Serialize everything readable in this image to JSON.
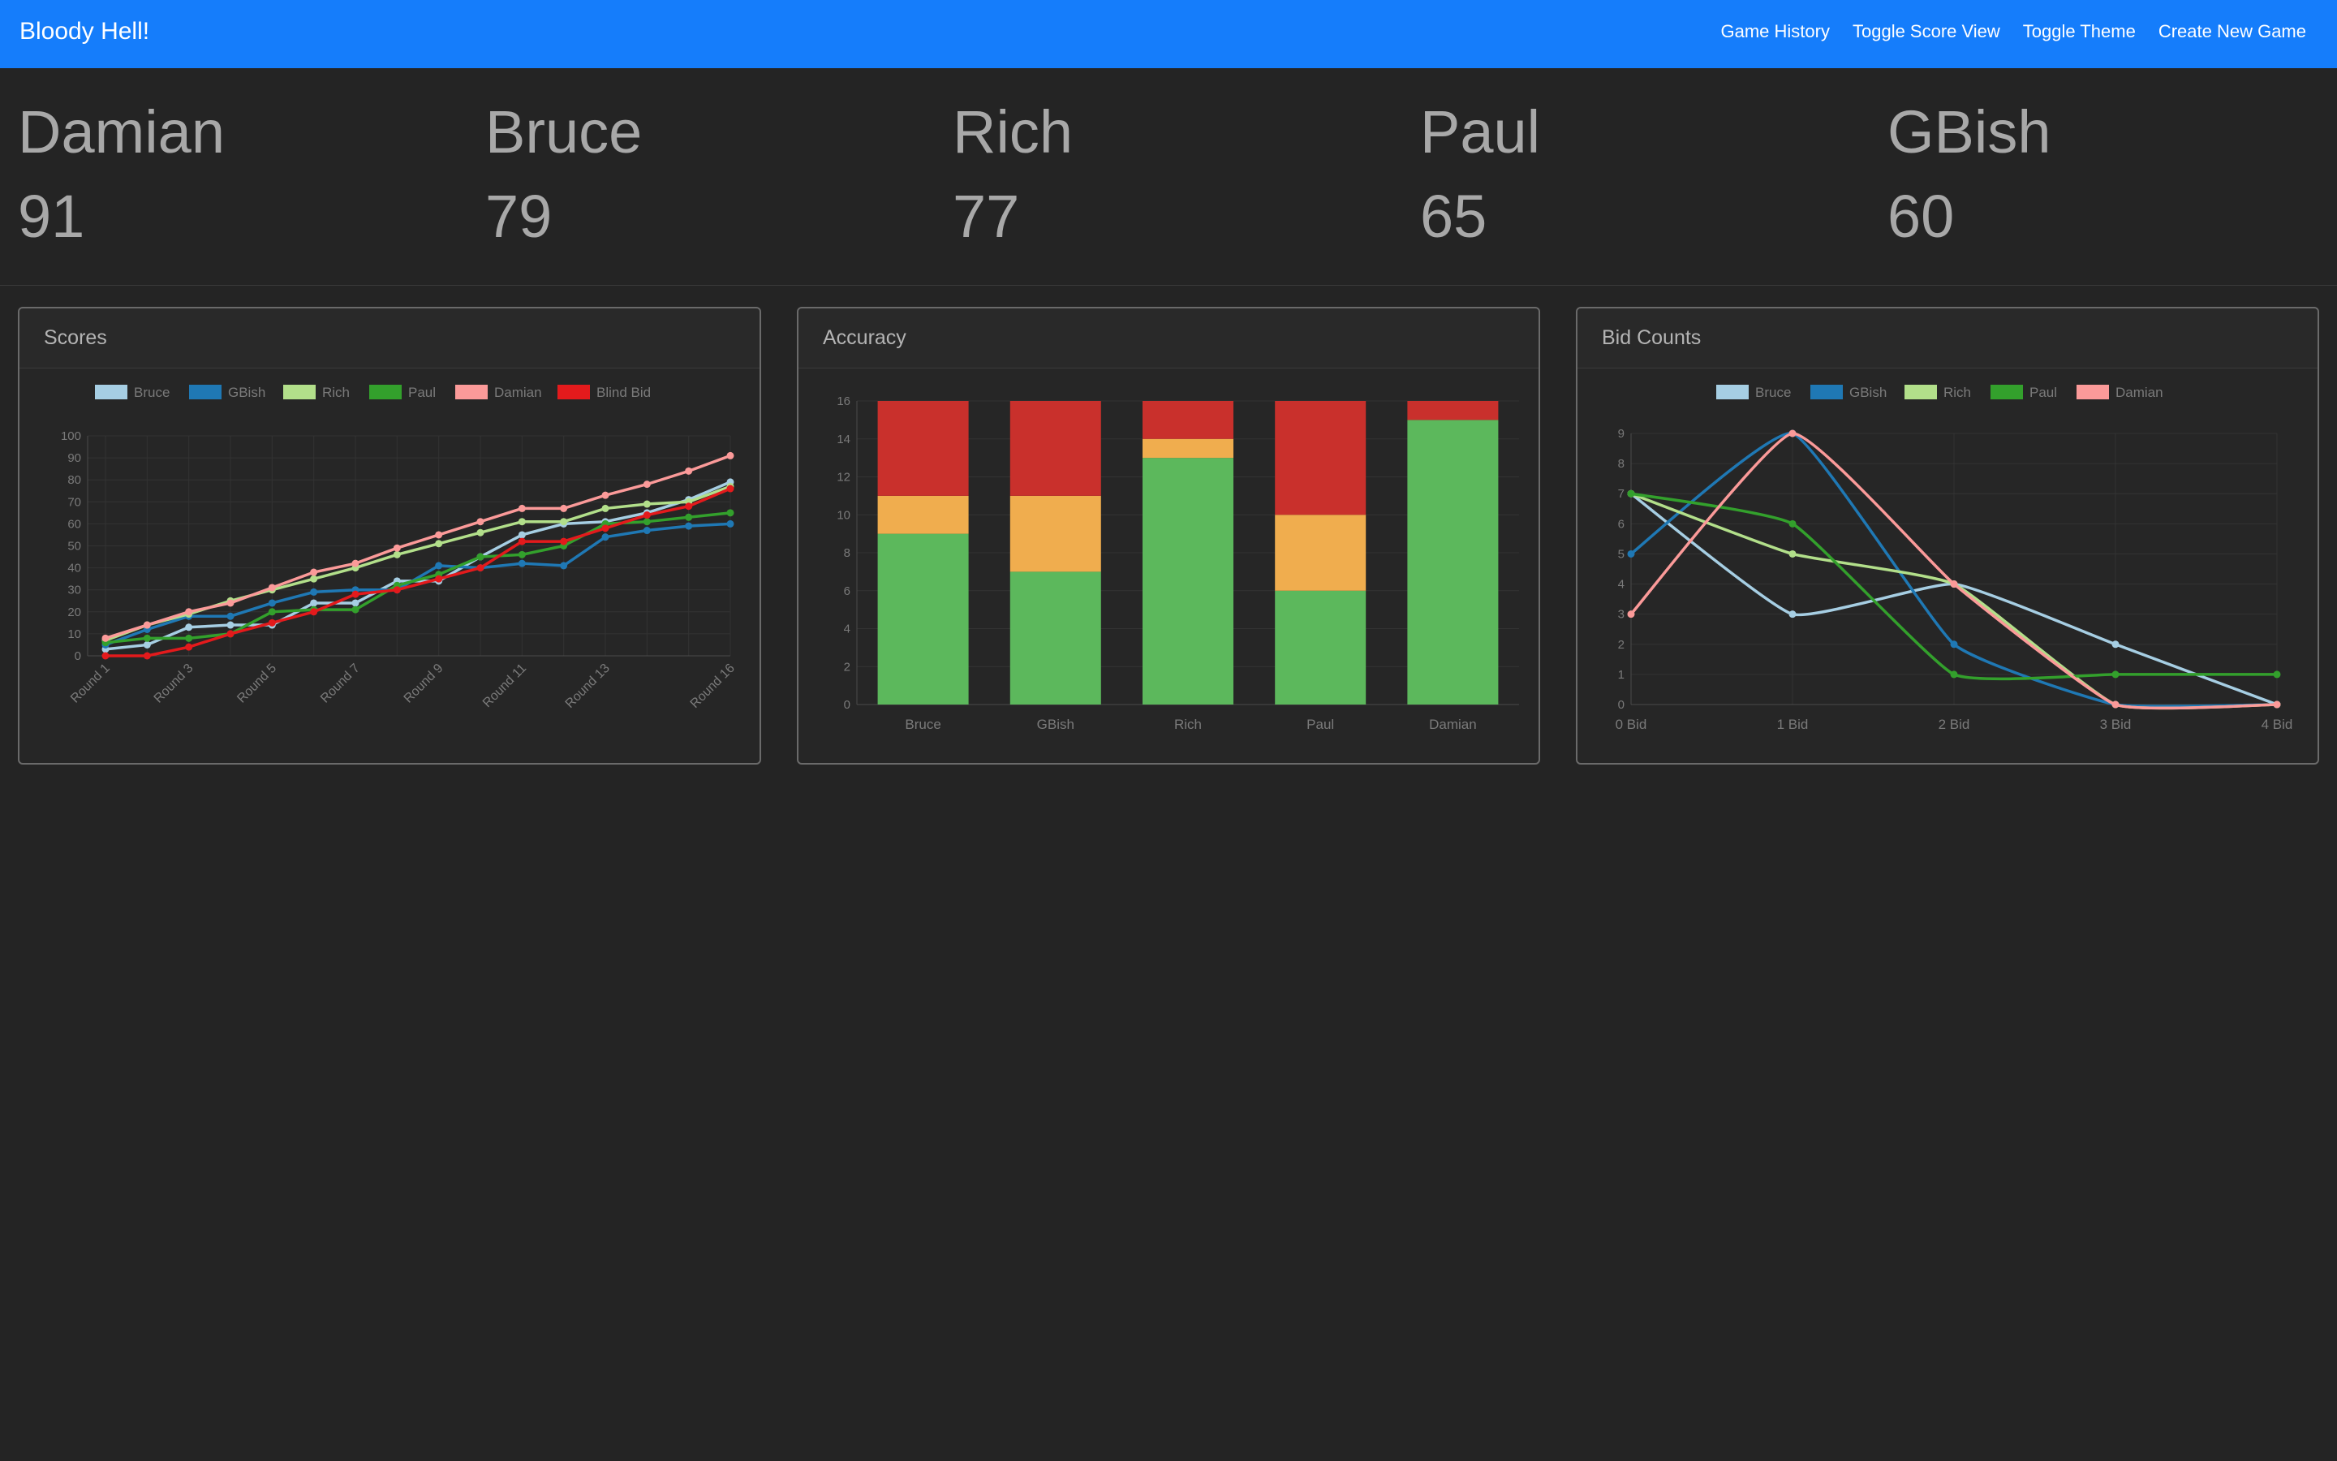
{
  "app": {
    "brand": "Bloody Hell!",
    "nav": [
      "Game History",
      "Toggle Score View",
      "Toggle Theme",
      "Create New Game"
    ],
    "accent": "#157dfb"
  },
  "scoreboard": [
    {
      "name": "Damian",
      "score": "91"
    },
    {
      "name": "Bruce",
      "score": "79"
    },
    {
      "name": "Rich",
      "score": "77"
    },
    {
      "name": "Paul",
      "score": "65"
    },
    {
      "name": "GBish",
      "score": "60"
    }
  ],
  "cards": {
    "scores": {
      "title": "Scores"
    },
    "accuracy": {
      "title": "Accuracy"
    },
    "bid_counts": {
      "title": "Bid Counts"
    }
  },
  "chart_data": [
    {
      "type": "line",
      "title": "Scores",
      "x": [
        "Round 1",
        "Round 2",
        "Round 3",
        "Round 4",
        "Round 5",
        "Round 6",
        "Round 7",
        "Round 8",
        "Round 9",
        "Round 10",
        "Round 11",
        "Round 12",
        "Round 13",
        "Round 14",
        "Round 15",
        "Round 16"
      ],
      "x_tick_labels": [
        "Round 1",
        "Round 3",
        "Round 5",
        "Round 7",
        "Round 9",
        "Round 11",
        "Round 13",
        "Round 16"
      ],
      "ylim": [
        0,
        100
      ],
      "y_ticks": [
        0,
        10,
        20,
        30,
        40,
        50,
        60,
        70,
        80,
        90,
        100
      ],
      "legend_position": "top",
      "grid": true,
      "series": [
        {
          "name": "Bruce",
          "color": "#a6cee3",
          "values": [
            3,
            5,
            13,
            14,
            14,
            24,
            24,
            34,
            34,
            45,
            55,
            60,
            61,
            65,
            71,
            79
          ]
        },
        {
          "name": "GBish",
          "color": "#1f78b4",
          "values": [
            5,
            12,
            18,
            18,
            24,
            29,
            30,
            30,
            41,
            40,
            42,
            41,
            54,
            57,
            59,
            60
          ]
        },
        {
          "name": "Rich",
          "color": "#b2df8a",
          "values": [
            7,
            14,
            19,
            25,
            30,
            35,
            40,
            46,
            51,
            56,
            61,
            61,
            67,
            69,
            70,
            77
          ]
        },
        {
          "name": "Paul",
          "color": "#33a02c",
          "values": [
            6,
            8,
            8,
            10,
            20,
            21,
            21,
            32,
            37,
            45,
            46,
            50,
            60,
            61,
            63,
            65
          ]
        },
        {
          "name": "Damian",
          "color": "#fb9a99",
          "values": [
            8,
            14,
            20,
            24,
            31,
            38,
            42,
            49,
            55,
            61,
            67,
            67,
            73,
            78,
            84,
            91
          ]
        },
        {
          "name": "Blind Bid",
          "color": "#e31a1c",
          "values": [
            0,
            0,
            4,
            10,
            15,
            20,
            28,
            30,
            35,
            40,
            52,
            52,
            58,
            64,
            68,
            76
          ]
        }
      ]
    },
    {
      "type": "bar",
      "stacked": true,
      "title": "Accuracy",
      "categories": [
        "Bruce",
        "GBish",
        "Rich",
        "Paul",
        "Damian"
      ],
      "ylim": [
        0,
        16
      ],
      "y_ticks": [
        0,
        2,
        4,
        6,
        8,
        10,
        12,
        14,
        16
      ],
      "series": [
        {
          "color": "#5cb85c",
          "values": [
            9,
            7,
            13,
            6,
            15
          ]
        },
        {
          "color": "#f0ad4e",
          "values": [
            2,
            4,
            1,
            4,
            0
          ]
        },
        {
          "color": "#c9302c",
          "values": [
            5,
            5,
            2,
            6,
            1
          ]
        }
      ]
    },
    {
      "type": "line",
      "smooth": true,
      "title": "Bid Counts",
      "x": [
        "0 Bid",
        "1 Bid",
        "2 Bid",
        "3 Bid",
        "4 Bid"
      ],
      "ylim": [
        0,
        9
      ],
      "y_ticks": [
        0,
        1,
        2,
        3,
        4,
        5,
        6,
        7,
        8,
        9
      ],
      "legend_position": "top",
      "grid": true,
      "series": [
        {
          "name": "Bruce",
          "color": "#a6cee3",
          "values": [
            7,
            3,
            4,
            2,
            0
          ]
        },
        {
          "name": "GBish",
          "color": "#1f78b4",
          "values": [
            5,
            9,
            2,
            0,
            0
          ]
        },
        {
          "name": "Rich",
          "color": "#b2df8a",
          "values": [
            7,
            5,
            4,
            0,
            0
          ]
        },
        {
          "name": "Paul",
          "color": "#33a02c",
          "values": [
            7,
            6,
            1,
            1,
            1
          ]
        },
        {
          "name": "Damian",
          "color": "#fb9a99",
          "values": [
            3,
            9,
            4,
            0,
            0
          ]
        }
      ]
    }
  ]
}
